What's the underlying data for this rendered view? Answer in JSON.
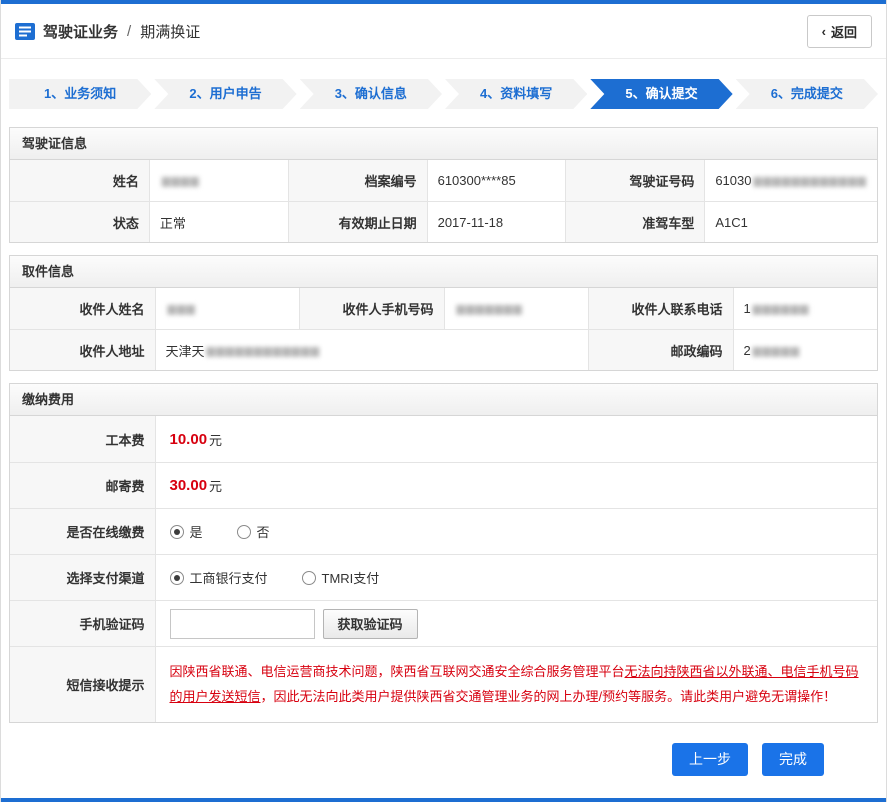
{
  "colors": {
    "accent": "#1d6ed2",
    "primary": "#1a73e8",
    "danger": "#d7000f"
  },
  "header": {
    "title": "驾驶证业务",
    "separator": "/",
    "subtitle": "期满换证",
    "back_chevron": "‹",
    "back_label": "返回"
  },
  "steps": [
    {
      "label": "1、业务须知"
    },
    {
      "label": "2、用户申告"
    },
    {
      "label": "3、确认信息"
    },
    {
      "label": "4、资料填写"
    },
    {
      "label": "5、确认提交"
    },
    {
      "label": "6、完成提交"
    }
  ],
  "active_step_index": 4,
  "license": {
    "title": "驾驶证信息",
    "name_label": "姓名",
    "name_masked": "▆▆▆▆",
    "file_label": "档案编号",
    "file_value": "610300****85",
    "licenseno_label": "驾驶证号码",
    "licenseno_prefix": "61030",
    "licenseno_masked": "▆▆▆▆▆▆▆▆▆▆▆▆",
    "status_label": "状态",
    "status_value": "正常",
    "expiry_label": "有效期止日期",
    "expiry_value": "2017-11-18",
    "class_label": "准驾车型",
    "class_value": "A1C1"
  },
  "pickup": {
    "title": "取件信息",
    "recipient_label": "收件人姓名",
    "recipient_masked": "▆▆▆",
    "mobile_label": "收件人手机号码",
    "mobile_masked": "▆▆▆▆▆▆▆",
    "phone_label": "收件人联系电话",
    "phone_prefix": "1",
    "phone_masked": "▆▆▆▆▆▆",
    "address_label": "收件人地址",
    "address_prefix": "天津天",
    "address_masked": "▆▆▆▆▆▆▆▆▆▆▆▆",
    "postcode_label": "邮政编码",
    "postcode_prefix": "2",
    "postcode_masked": "▆▆▆▆▆"
  },
  "fees": {
    "title": "缴纳费用",
    "cost_label": "工本费",
    "cost_amount": "10.00",
    "cost_unit": "元",
    "postage_label": "邮寄费",
    "postage_amount": "30.00",
    "postage_unit": "元",
    "online_label": "是否在线缴费",
    "online_yes": "是",
    "online_no": "否",
    "channel_label": "选择支付渠道",
    "channel_icbc": "工商银行支付",
    "channel_tmri": "TMRI支付",
    "captcha_label": "手机验证码",
    "captcha_button": "获取验证码",
    "sms_label": "短信接收提示",
    "sms_pre": "因陕西省联通、电信运营商技术问题，陕西省互联网交通安全综合服务管理平台",
    "sms_underline": "无法向持陕西省以外联通、电信手机号码的用户发送短信",
    "sms_post": "，因此无法向此类用户提供陕西省交通管理业务的网上办理/预约等服务。请此类用户避免无谓操作！"
  },
  "footer": {
    "prev_label": "上一步",
    "finish_label": "完成"
  }
}
